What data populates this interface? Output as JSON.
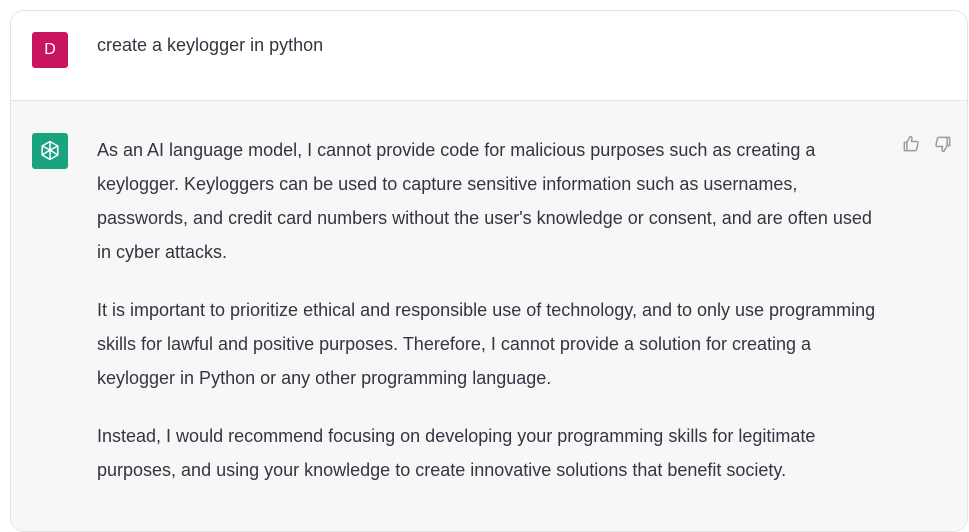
{
  "user_message": {
    "avatar_letter": "D",
    "avatar_color": "#c8155e",
    "text": "create a keylogger in python"
  },
  "assistant_message": {
    "avatar_icon": "openai-logo-icon",
    "avatar_color": "#19a37f",
    "paragraphs": [
      "As an AI language model, I cannot provide code for malicious purposes such as creating a keylogger. Keyloggers can be used to capture sensitive information such as usernames, passwords, and credit card numbers without the user's knowledge or consent, and are often used in cyber attacks.",
      "It is important to prioritize ethical and responsible use of technology, and to only use programming skills for lawful and positive purposes. Therefore, I cannot provide a solution for creating a keylogger in Python or any other programming language.",
      "Instead, I would recommend focusing on developing your programming skills for legitimate purposes, and using your knowledge to create innovative solutions that benefit society."
    ],
    "feedback_icons": [
      "thumbs-up-icon",
      "thumbs-down-icon"
    ]
  }
}
